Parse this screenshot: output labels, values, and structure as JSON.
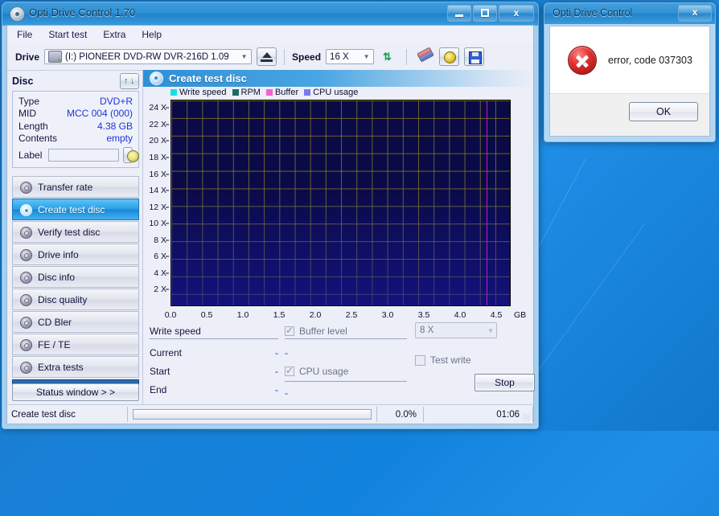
{
  "window": {
    "title": "Opti Drive Control 1.70",
    "icon": "disc-icon",
    "buttons": {
      "minimize": "–",
      "maximize": "□",
      "close": "x"
    }
  },
  "menu": {
    "items": [
      "File",
      "Start test",
      "Extra",
      "Help"
    ]
  },
  "toolbar": {
    "drive_label": "Drive",
    "drive_value": "(I:)  PIONEER DVD-RW  DVR-216D 1.09",
    "eject_tooltip": "Eject",
    "speed_label": "Speed",
    "speed_value": "16 X",
    "icons": [
      "refresh-icon",
      "eraser-icon",
      "tools-icon",
      "save-icon"
    ]
  },
  "disc": {
    "header": "Disc",
    "refresh_icon": "refresh-arrows-icon",
    "rows": [
      {
        "key": "Type",
        "value": "DVD+R"
      },
      {
        "key": "MID",
        "value": "MCC 004 (000)"
      },
      {
        "key": "Length",
        "value": "4.38 GB"
      },
      {
        "key": "Contents",
        "value": "empty"
      }
    ],
    "label_key": "Label",
    "label_value": "",
    "label_placeholder": ""
  },
  "sidebar": {
    "items": [
      {
        "label": "Transfer rate",
        "active": false
      },
      {
        "label": "Create test disc",
        "active": true
      },
      {
        "label": "Verify test disc",
        "active": false
      },
      {
        "label": "Drive info",
        "active": false
      },
      {
        "label": "Disc info",
        "active": false
      },
      {
        "label": "Disc quality",
        "active": false
      },
      {
        "label": "CD Bler",
        "active": false
      },
      {
        "label": "FE / TE",
        "active": false
      },
      {
        "label": "Extra tests",
        "active": false
      }
    ],
    "status_window_button": "Status window > >"
  },
  "panel": {
    "title": "Create test disc",
    "icon": "disc-burn-icon"
  },
  "chart_data": {
    "type": "line",
    "title": "Create test disc",
    "xlabel": "GB",
    "ylabel": "X",
    "xlim": [
      0.0,
      4.7
    ],
    "ylim": [
      0,
      25
    ],
    "x_ticks": [
      "0.0",
      "0.5",
      "1.0",
      "1.5",
      "2.0",
      "2.5",
      "3.0",
      "3.5",
      "4.0",
      "4.5"
    ],
    "x_tick_values": [
      0.0,
      0.5,
      1.0,
      1.5,
      2.0,
      2.5,
      3.0,
      3.5,
      4.0,
      4.5
    ],
    "x_unit": "GB",
    "y_ticks": [
      "2 X",
      "4 X",
      "6 X",
      "8 X",
      "10 X",
      "12 X",
      "14 X",
      "16 X",
      "18 X",
      "20 X",
      "22 X",
      "24 X"
    ],
    "y_tick_values": [
      2,
      4,
      6,
      8,
      10,
      12,
      14,
      16,
      18,
      20,
      22,
      24
    ],
    "grid": true,
    "legend_position": "top-left",
    "plot_bg": "#0a0a46",
    "grid_color": "#8c8228",
    "capacity_marker": {
      "value": 4.38,
      "color": "#c01fc0"
    },
    "legend": [
      {
        "name": "Write speed",
        "color": "#19e0e0"
      },
      {
        "name": "RPM",
        "color": "#1d6b63"
      },
      {
        "name": "Buffer",
        "color": "#f561d2"
      },
      {
        "name": "CPU usage",
        "color": "#7b7bf0"
      }
    ],
    "series": [
      {
        "name": "Write speed",
        "color": "#19e0e0",
        "values": []
      },
      {
        "name": "RPM",
        "color": "#1d6b63",
        "values": []
      },
      {
        "name": "Buffer",
        "color": "#f561d2",
        "values": []
      },
      {
        "name": "CPU usage",
        "color": "#7b7bf0",
        "values": []
      }
    ]
  },
  "stats": {
    "write_speed_header": "Write speed",
    "rows": [
      {
        "key": "Current",
        "value": "-",
        "mid": "-"
      },
      {
        "key": "Start",
        "value": "-",
        "mid": ""
      },
      {
        "key": "End",
        "value": "-",
        "mid": "-"
      }
    ],
    "buffer_level": "Buffer level",
    "buffer_checked": true,
    "cpu_usage": "CPU usage",
    "cpu_checked": true,
    "speed_select": "8 X",
    "test_write": "Test write",
    "test_write_checked": false,
    "stop_button": "Stop"
  },
  "statusbar": {
    "task": "Create test disc",
    "percent": "0.0%",
    "progress_value": 0.0,
    "time": "01:06"
  },
  "dialog": {
    "title": "Opti Drive Control",
    "close": "x",
    "icon": "error-icon",
    "message": "error, code 037303",
    "ok_button": "OK"
  }
}
